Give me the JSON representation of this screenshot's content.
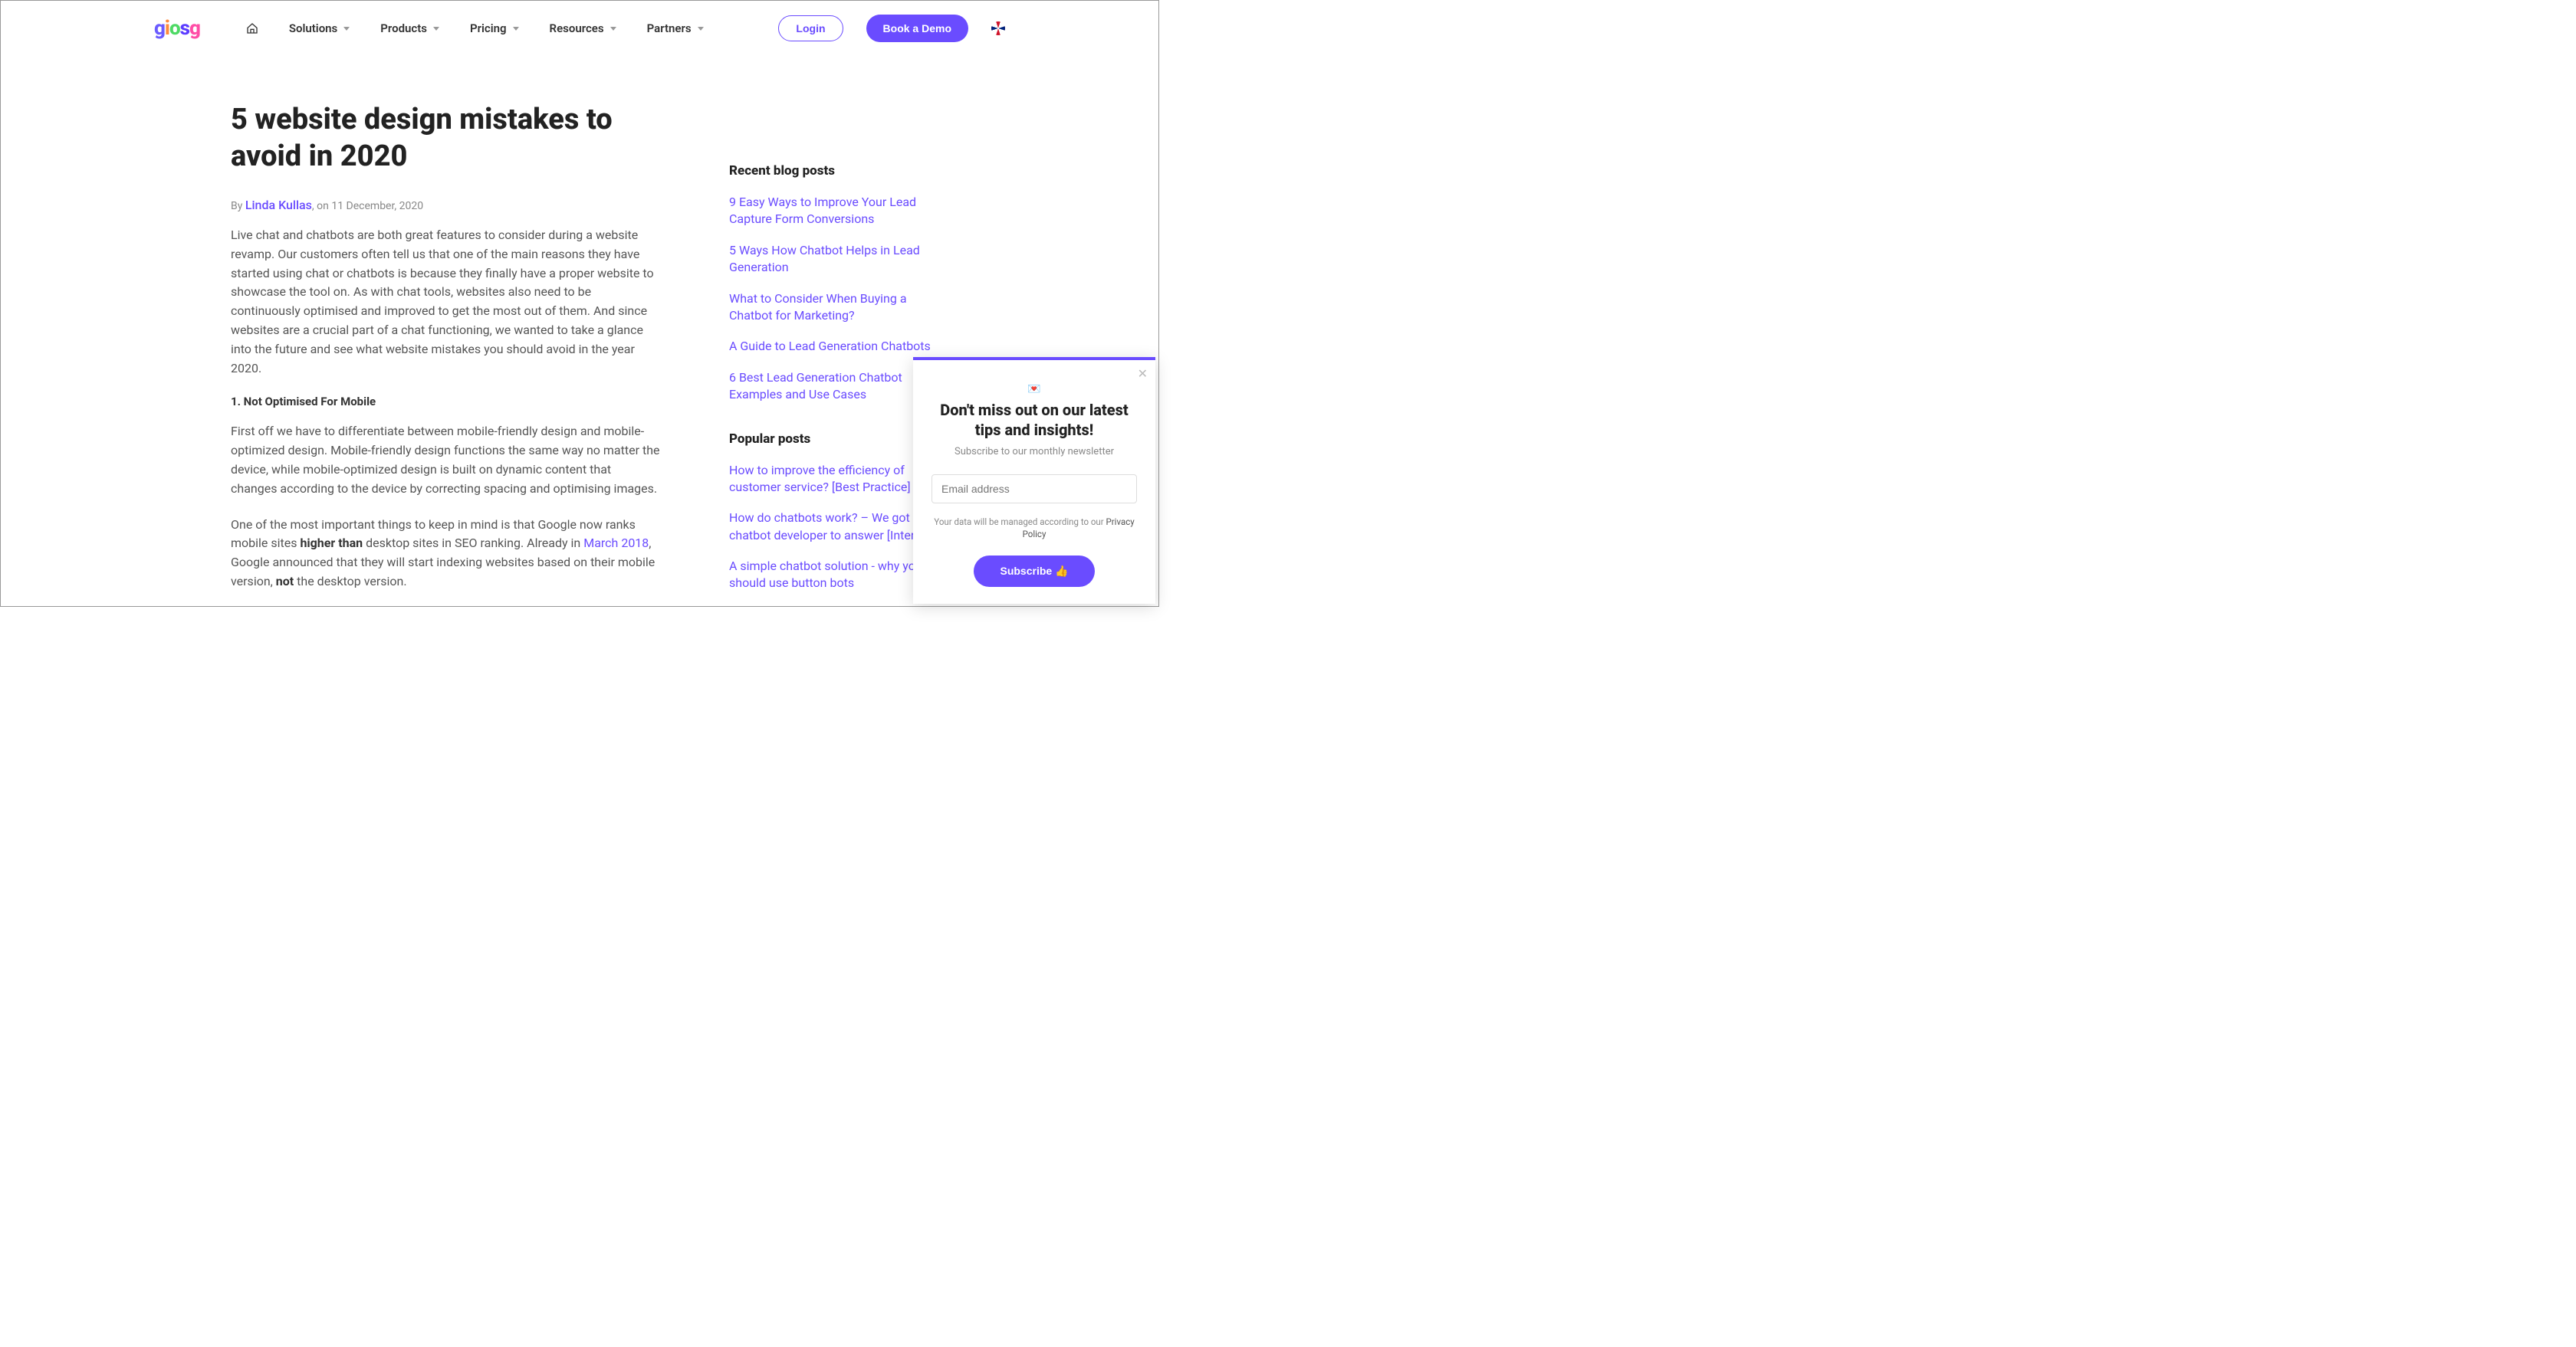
{
  "header": {
    "logo_text": "giosg",
    "nav": {
      "solutions": "Solutions",
      "products": "Products",
      "pricing": "Pricing",
      "resources": "Resources",
      "partners": "Partners"
    },
    "login": "Login",
    "demo": "Book a Demo"
  },
  "article": {
    "title": "5 website design mistakes to avoid in 2020",
    "by_prefix": "By ",
    "author": "Linda Kullas",
    "date_prefix": ", on ",
    "date": "11 December, 2020",
    "p1": "Live chat and chatbots are both great features to consider during a website revamp. Our customers often tell us that one of the main reasons they have started using chat or chatbots is because they finally have a proper website to showcase the tool on. As with chat tools, websites also need to be continuously optimised and improved to get the most out of them. And since websites are a crucial part of a chat functioning, we wanted to take a glance into the future and see what website mistakes you should avoid in the year 2020.",
    "h1": "1. Not Optimised For Mobile",
    "p2": "First off we have to differentiate between mobile-friendly design and mobile-optimized design. Mobile-friendly design functions the same way no matter the device, while mobile-optimized design is built on dynamic content that changes according to the device by correcting spacing and optimising images.",
    "p3_a": "One of the most important things to keep in mind is that Google now ranks mobile sites ",
    "p3_bold1": "higher than",
    "p3_b": " desktop sites in SEO ranking. Already in ",
    "p3_link": "March 2018",
    "p3_c": ", Google announced that they will start indexing websites based on their mobile version, ",
    "p3_bold2": "not",
    "p3_d": " the desktop version."
  },
  "sidebar": {
    "recent_head": "Recent blog posts",
    "recent": [
      "9 Easy Ways to Improve Your Lead Capture Form Conversions",
      "5 Ways How Chatbot Helps in Lead Generation",
      "What to Consider When Buying a Chatbot for Marketing?",
      "A Guide to Lead Generation Chatbots",
      "6 Best Lead Generation Chatbot Examples and Use Cases"
    ],
    "popular_head": "Popular posts",
    "popular": [
      "How to improve the efficiency of customer service? [Best Practice]",
      "How do chatbots work? – We got a chatbot developer to answer [Interview]",
      "A simple chatbot solution - why you should use button bots"
    ]
  },
  "popup": {
    "heart": "💌",
    "title": "Don't miss out on our latest tips and insights!",
    "subtitle": "Subscribe to our monthly newsletter",
    "placeholder": "Email address",
    "privacy_a": "Your data will be managed according to our ",
    "privacy_link": "Privacy Policy",
    "subscribe": "Subscribe 👍"
  }
}
